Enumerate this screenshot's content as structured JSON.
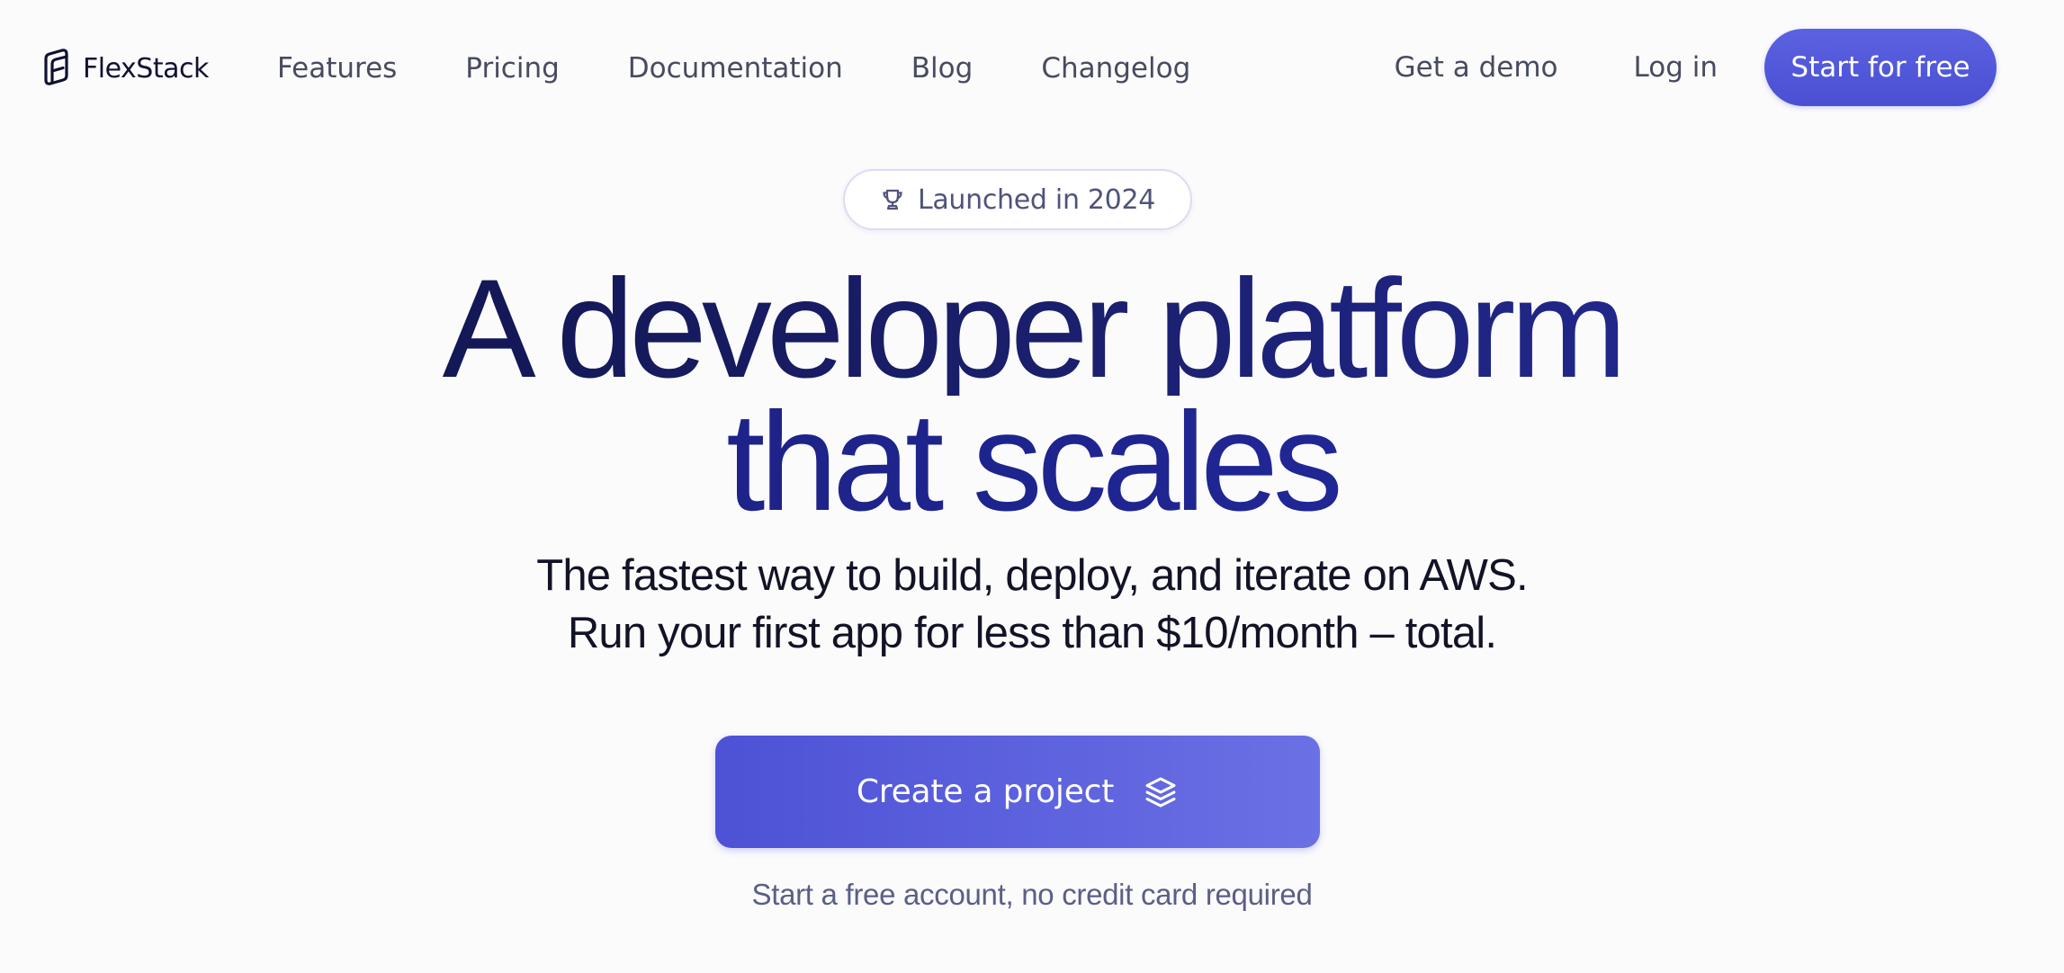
{
  "brand": {
    "name": "FlexStack",
    "icon": "flexstack-logo-icon"
  },
  "nav": {
    "links": [
      "Features",
      "Pricing",
      "Documentation",
      "Blog",
      "Changelog"
    ],
    "demo_label": "Get a demo",
    "login_label": "Log in",
    "cta_label": "Start for free"
  },
  "badge": {
    "icon": "trophy-icon",
    "text": "Launched in 2024"
  },
  "hero": {
    "headline_line1": "A developer platform",
    "headline_line2": "that scales",
    "sub_line1": "The fastest way to build, deploy, and iterate on AWS.",
    "sub_line2": "Run your first app for less than $10/month – total.",
    "cta_label": "Create a project",
    "cta_icon": "stack-layers-icon",
    "note": "Start a free account, no credit card required"
  },
  "colors": {
    "accent": "#4f55d8",
    "headline_dark": "#0e1244",
    "headline_blue": "#232aa4",
    "background": "#fbfbfc"
  }
}
